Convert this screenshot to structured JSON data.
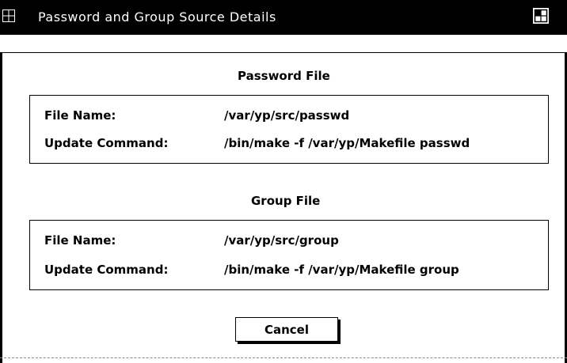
{
  "window": {
    "title": "Password and Group Source Details"
  },
  "password_file": {
    "heading": "Password File",
    "file_name_label": "File Name:",
    "file_name_value": "/var/yp/src/passwd",
    "update_command_label": "Update Command:",
    "update_command_value": "/bin/make -f /var/yp/Makefile passwd"
  },
  "group_file": {
    "heading": "Group File",
    "file_name_label": "File Name:",
    "file_name_value": "/var/yp/src/group",
    "update_command_label": "Update Command:",
    "update_command_value": "/bin/make -f /var/yp/Makefile group"
  },
  "buttons": {
    "cancel_label": "Cancel"
  },
  "icons": {
    "window_menu": "window-menu-icon",
    "maximize": "maximize-icon"
  }
}
